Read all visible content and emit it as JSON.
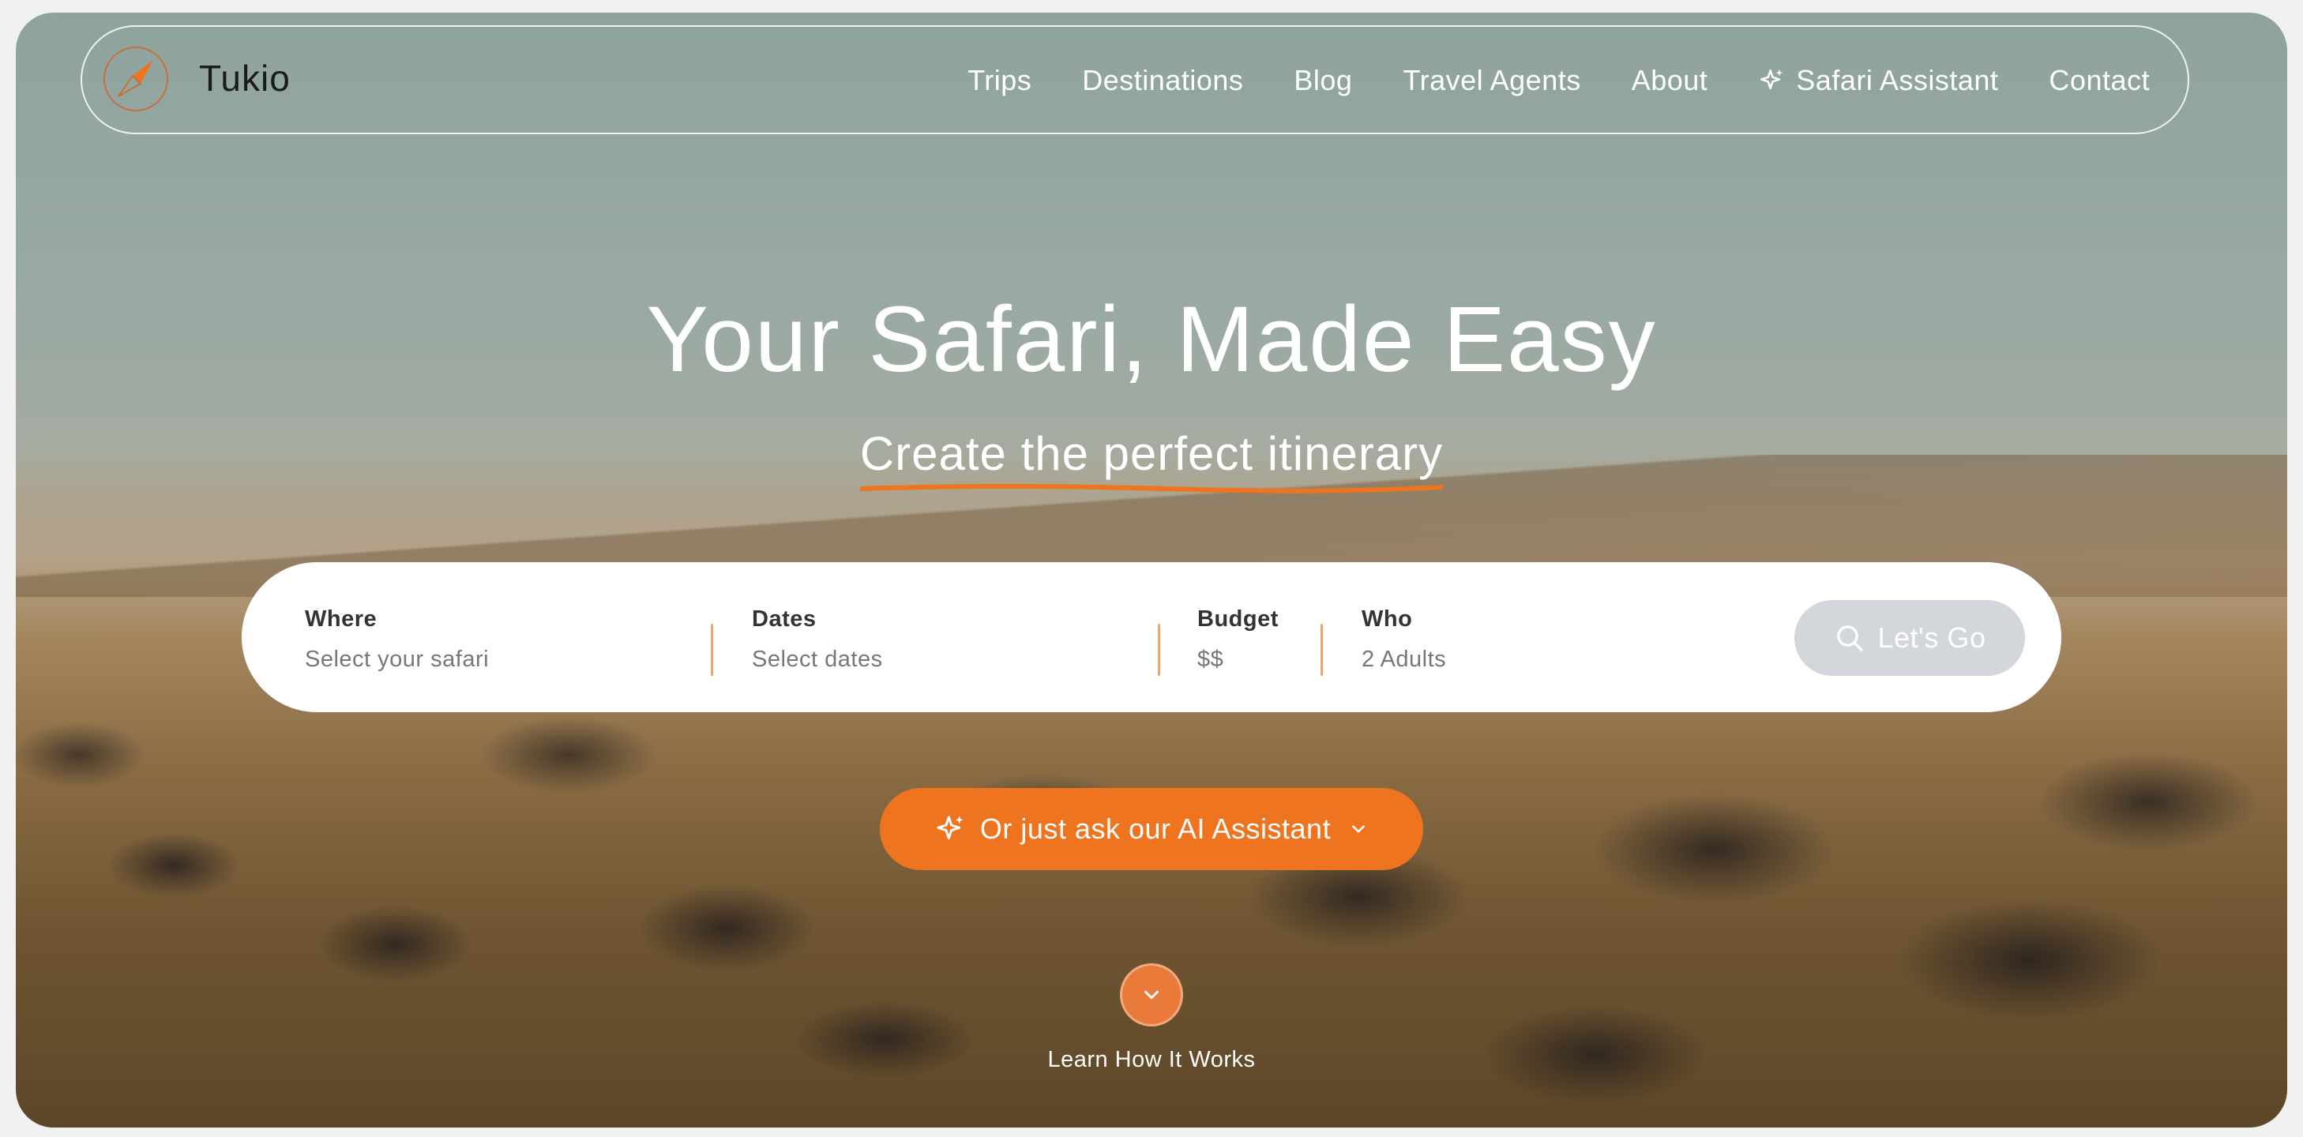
{
  "brand": {
    "name": "Tukio"
  },
  "nav": {
    "items": [
      {
        "label": "Trips"
      },
      {
        "label": "Destinations"
      },
      {
        "label": "Blog"
      },
      {
        "label": "Travel Agents"
      },
      {
        "label": "About"
      },
      {
        "label": "Safari Assistant",
        "icon": "sparkle-icon"
      },
      {
        "label": "Contact"
      }
    ]
  },
  "hero": {
    "title": "Your Safari, Made Easy",
    "subtitle": "Create the perfect itinerary",
    "accent_color": "#ee7420"
  },
  "search": {
    "where": {
      "label": "Where",
      "value": "Select your safari"
    },
    "dates": {
      "label": "Dates",
      "value": "Select dates"
    },
    "budget": {
      "label": "Budget",
      "value": "$$"
    },
    "who": {
      "label": "Who",
      "value": "2 Adults"
    },
    "submit_label": "Let's Go",
    "submit_icon": "search-icon"
  },
  "ai": {
    "label": "Or just ask our AI Assistant",
    "icon": "sparkle-icon"
  },
  "learn": {
    "label": "Learn How It Works",
    "icon": "chevron-down-icon"
  }
}
